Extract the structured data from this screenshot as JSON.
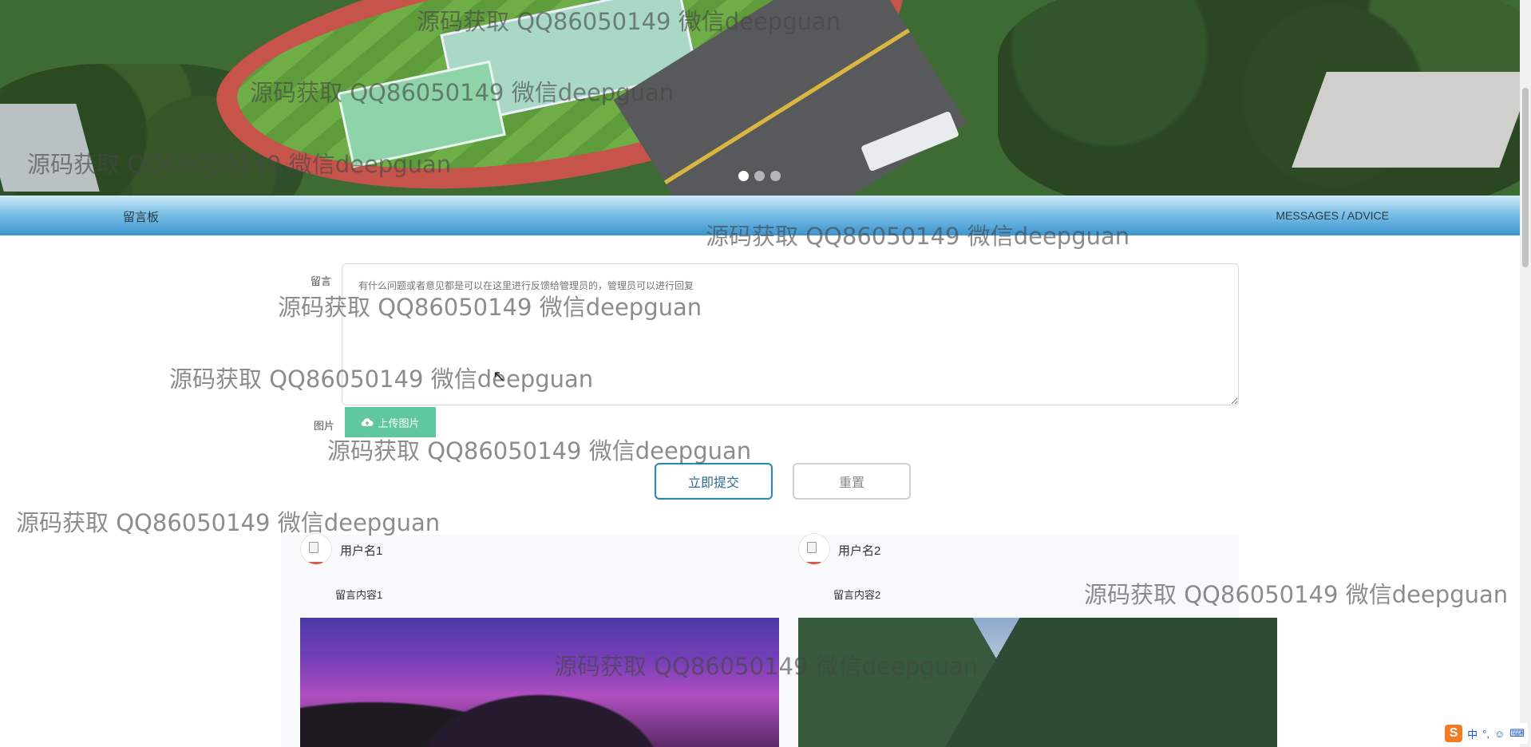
{
  "carousel": {
    "dots": [
      {
        "active": true
      },
      {
        "active": false
      },
      {
        "active": false
      }
    ]
  },
  "section": {
    "title": "留言板",
    "subtitle": "MESSAGES / ADVICE"
  },
  "form": {
    "message_label": "留言",
    "message_placeholder": "有什么问题或者意见都是可以在这里进行反馈给管理员的，管理员可以进行回复",
    "image_label": "图片",
    "upload_label": "上传图片",
    "submit_label": "立即提交",
    "reset_label": "重置"
  },
  "messages": [
    {
      "username": "用户名1",
      "content": "留言内容1"
    },
    {
      "username": "用户名2",
      "content": "留言内容2"
    }
  ],
  "watermark": "源码获取 QQ86050149 微信deepguan",
  "ime": {
    "lang": "中",
    "punct": "°,",
    "emoji": "☺"
  },
  "colors": {
    "accent": "#3d95cf",
    "upload": "#5fc89e",
    "submit_border": "#2e88b0"
  }
}
